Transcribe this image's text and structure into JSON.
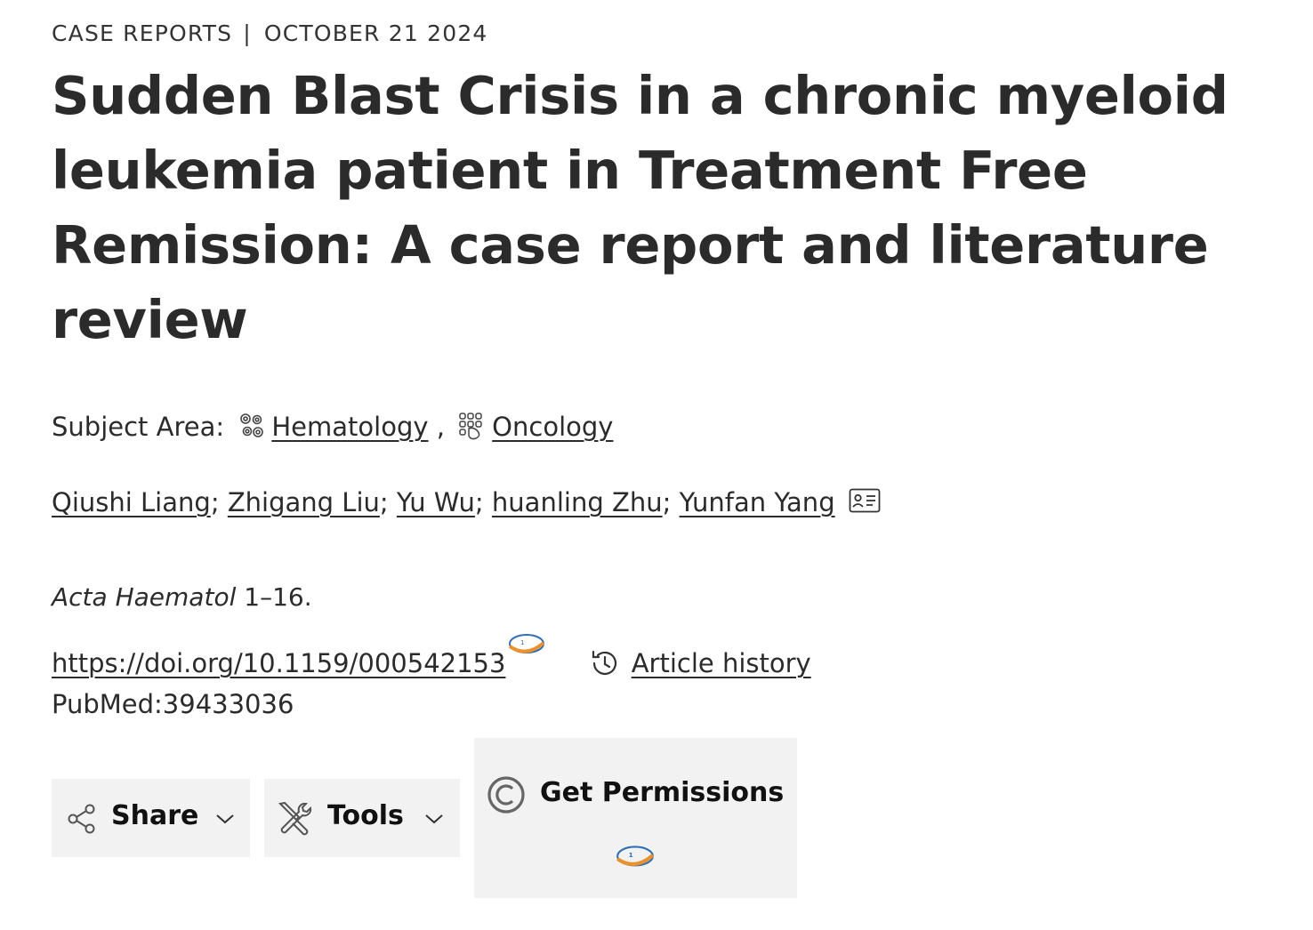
{
  "header": {
    "category": "CASE REPORTS",
    "separator": "|",
    "date": "OCTOBER 21 2024"
  },
  "article": {
    "title": "Sudden Blast Crisis in a chronic myeloid leukemia patient in Treatment Free Remission: A case report and literature review"
  },
  "subject_area": {
    "label": "Subject Area:",
    "items": [
      {
        "label": "Hematology",
        "icon": "hematology-icon"
      },
      {
        "label": "Oncology",
        "icon": "oncology-icon"
      }
    ],
    "separator": ","
  },
  "authors": {
    "list": [
      "Qiushi Liang",
      "Zhigang Liu",
      "Yu Wu",
      "huanling Zhu",
      "Yunfan Yang"
    ],
    "separator": ";",
    "icon": "author-card-icon"
  },
  "citation": {
    "journal": "Acta Haematol",
    "pages": "1–16."
  },
  "doi": {
    "url": "https://doi.org/10.1159/000542153",
    "badge_icon": "altmetric-badge-icon"
  },
  "history": {
    "label": "Article history",
    "icon": "history-icon"
  },
  "pubmed": {
    "text": "PubMed:39433036"
  },
  "toolbar": {
    "share_label": "Share",
    "tools_label": "Tools",
    "permissions_label": "Get Permissions"
  },
  "colors": {
    "text": "#2b2b2b",
    "button_bg": "#f2f2f2",
    "icon_gray": "#555555",
    "badge_blue": "#2f6fb5",
    "badge_orange": "#e8912d"
  }
}
